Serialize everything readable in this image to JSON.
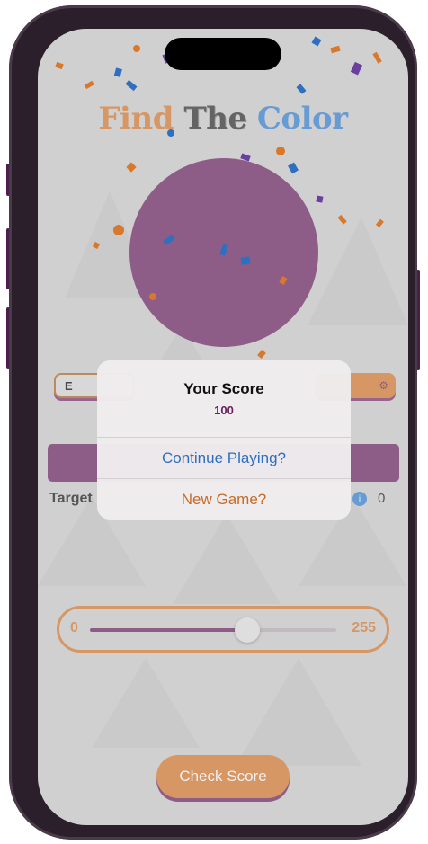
{
  "game": {
    "title_part1": "Find",
    "title_part2": "The",
    "title_part3": "Color",
    "target_label": "Target",
    "round_value": "0",
    "round_icon": "i",
    "left_pill_text": "E",
    "right_pill_icon": "settings-icon"
  },
  "slider": {
    "min_label": "0",
    "max_label": "255",
    "value": 163,
    "max": 255
  },
  "check_button_label": "Check Score",
  "alert": {
    "title": "Your Score",
    "message": "100",
    "continue_label": "Continue Playing?",
    "new_game_label": "New Game?"
  },
  "colors": {
    "accent_orange": "#d9782b",
    "target_purple": "#6b2060",
    "title_blue": "#2f7fd6"
  }
}
